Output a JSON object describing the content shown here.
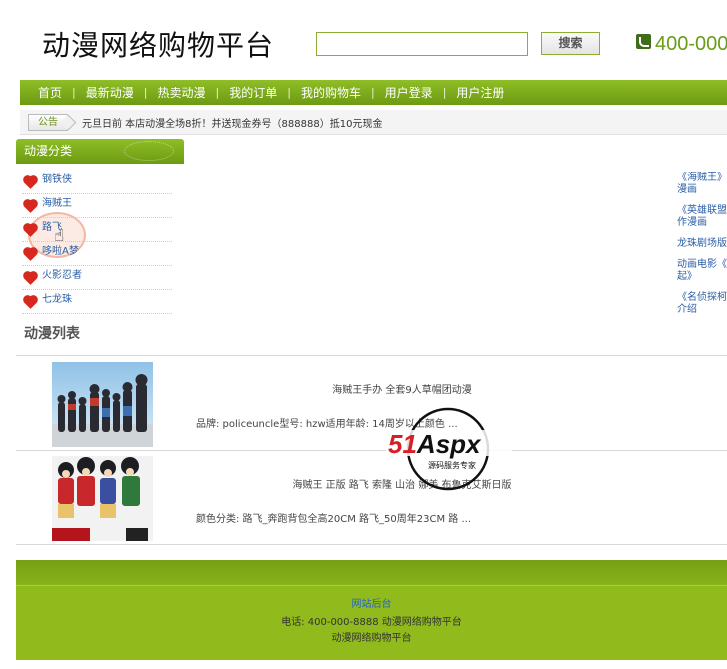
{
  "header": {
    "site_title": "动漫网络购物平台",
    "search_input_value": "",
    "search_button_label": "搜索",
    "phone": "400-000"
  },
  "nav": {
    "items": [
      "首页",
      "最新动漫",
      "热卖动漫",
      "我的订单",
      "我的购物车",
      "用户登录",
      "用户注册"
    ],
    "separator": "|"
  },
  "notice": {
    "badge": "公告",
    "text": "元旦日前 本店动漫全场8折！并送现金券号（888888）抵10元现金"
  },
  "category": {
    "title": "动漫分类",
    "items": [
      "钢铁侠",
      "海贼王",
      "路飞",
      "哆啦A梦",
      "火影忍者",
      "七龙珠"
    ]
  },
  "news": {
    "items": [
      {
        "line1": "《海贼王》",
        "line2": "漫画"
      },
      {
        "line1": "《英雄联盟",
        "line2": "作漫画"
      },
      {
        "line1": "龙珠剧场版",
        "line2": ""
      },
      {
        "line1": "动画电影《",
        "line2": "起》"
      },
      {
        "line1": "《名侦探柯",
        "line2": "介绍"
      }
    ]
  },
  "anime_list": {
    "title": "动漫列表",
    "products": [
      {
        "name": "海贼王手办 全套9人草帽团动漫",
        "desc": "品牌: policeuncle型号: hzw适用年龄: 14周岁以上颜色 ..."
      },
      {
        "name": "海贼王 正版 路飞 索隆 山治 娜美 布鲁克艾斯日版",
        "desc": "颜色分类: 路飞_奔跑背包全高20CM 路飞_50周年23CM 路 ..."
      }
    ]
  },
  "watermark": {
    "brand": "51Aspx",
    "tagline": "源码服务专家"
  },
  "footer": {
    "admin_link": "网站后台",
    "contact": "电话: 400-000-8888 动漫网络购物平台",
    "copyright": "动漫网络购物平台"
  },
  "colors": {
    "nav_green": "#7aa918",
    "footer_green": "#91bb1c",
    "link_blue": "#2b5fa6",
    "heart_red": "#d6281e",
    "phone_green": "#6b9b17"
  }
}
